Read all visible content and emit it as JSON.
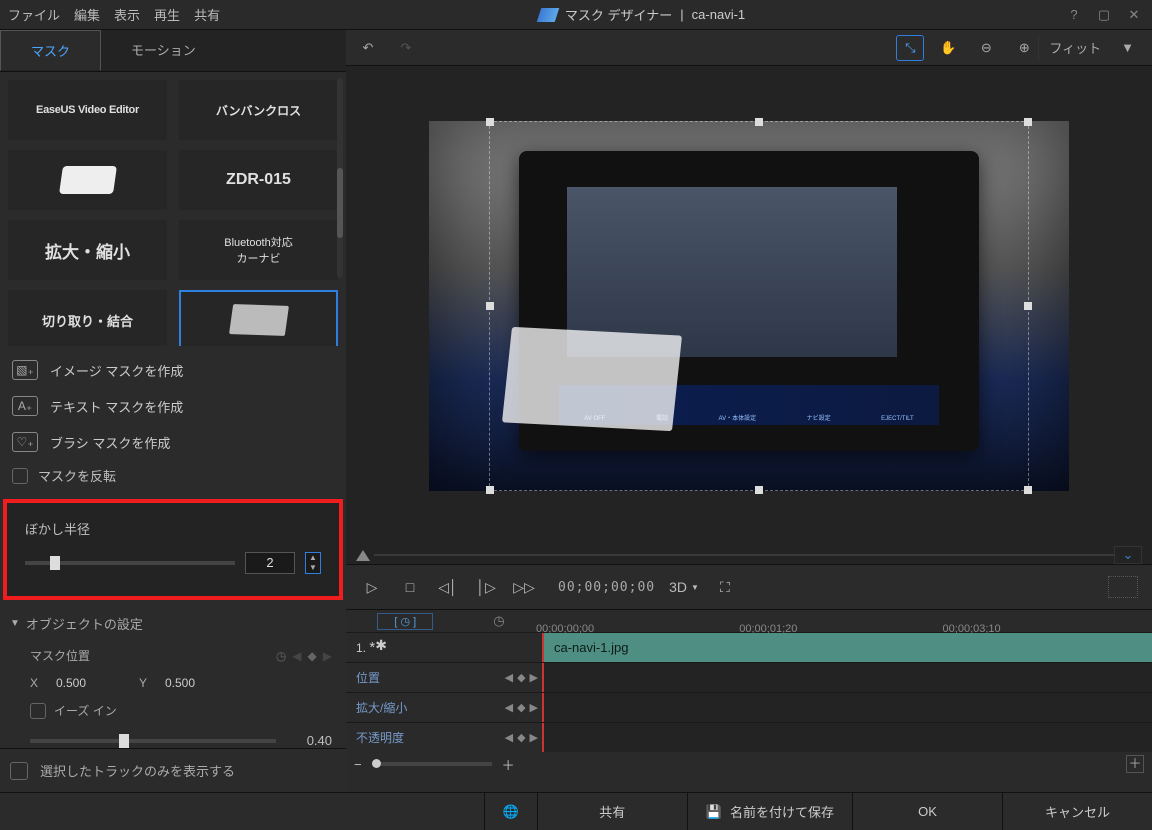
{
  "title": {
    "app": "マスク デザイナー",
    "sep": "|",
    "file": "ca-navi-1"
  },
  "menu": {
    "file": "ファイル",
    "edit": "編集",
    "view": "表示",
    "play": "再生",
    "share": "共有"
  },
  "tabs": {
    "mask": "マスク",
    "motion": "モーション"
  },
  "thumbs": [
    "EaseUS Video Editor",
    "バンバンクロス",
    "",
    "ZDR-015",
    "拡大・縮小",
    "Bluetooth対応\nカーナビ",
    "切り取り・結合",
    ""
  ],
  "actions": {
    "image": "イメージ マスクを作成",
    "text": "テキスト マスクを作成",
    "brush": "ブラシ マスクを作成",
    "invert": "マスクを反転"
  },
  "blur": {
    "label": "ぼかし半径",
    "value": "2"
  },
  "section": {
    "object": "オブジェクトの設定"
  },
  "obj": {
    "maskpos": "マスク位置",
    "x_label": "X",
    "x": "0.500",
    "y_label": "Y",
    "y": "0.500",
    "easein": "イーズ イン",
    "easeval": "0.40"
  },
  "showonly": "選択したトラックのみを表示する",
  "fit": "フィット",
  "timecode": "00;00;00;00",
  "threed": "3D",
  "ruler": {
    "t0": "00;00;00;00",
    "t1": "00;00;01;20",
    "t2": "00;00;03;10"
  },
  "clip": {
    "index": "1.",
    "name": "ca-navi-1.jpg"
  },
  "tracks": {
    "pos": "位置",
    "scale": "拡大/縮小",
    "opacity": "不透明度"
  },
  "bottom": {
    "share": "共有",
    "saveas": "名前を付けて保存",
    "ok": "OK",
    "cancel": "キャンセル"
  }
}
